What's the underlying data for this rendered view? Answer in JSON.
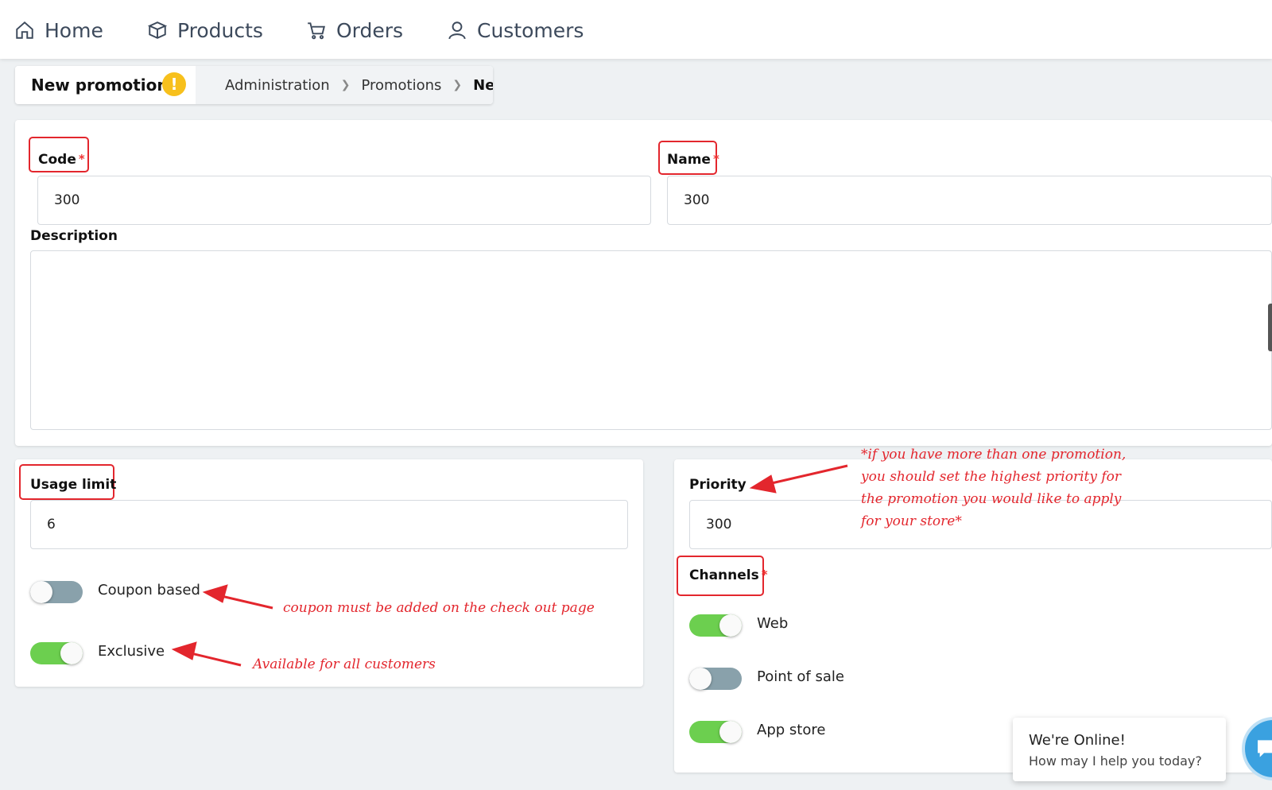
{
  "nav": {
    "home": "Home",
    "products": "Products",
    "orders": "Orders",
    "customers": "Customers"
  },
  "header": {
    "title": "New promotion",
    "warning": "!",
    "breadcrumb": [
      "Administration",
      "Promotions",
      "New"
    ]
  },
  "form": {
    "code_label": "Code",
    "code_value": "300",
    "name_label": "Name",
    "name_value": "300",
    "required_mark": "*",
    "description_label": "Description",
    "usage_limit_label": "Usage limit",
    "usage_limit_value": "6",
    "priority_label": "Priority",
    "priority_value": "300",
    "channels_label": "Channels"
  },
  "toggles": {
    "coupon_based": {
      "label": "Coupon based",
      "on": false
    },
    "exclusive": {
      "label": "Exclusive",
      "on": true
    },
    "web": {
      "label": "Web",
      "on": true
    },
    "point_of_sale": {
      "label": "Point of sale",
      "on": false
    },
    "app_store": {
      "label": "App store",
      "on": true
    }
  },
  "annotations": {
    "coupon": "coupon must be added on the check out page",
    "exclusive": "Available for all customers",
    "priority_lines": [
      "*if you  have more than one promotion,",
      "you should set the highest priority for",
      "the promotion you would like to apply",
      "for your store*"
    ]
  },
  "chat": {
    "title": "We're Online!",
    "subtitle": "How may I help you today?"
  },
  "colors": {
    "annotation_red": "#e3262d",
    "toggle_on": "#6ccf4f",
    "toggle_off": "#89a1ab",
    "warning": "#f7c01c"
  }
}
